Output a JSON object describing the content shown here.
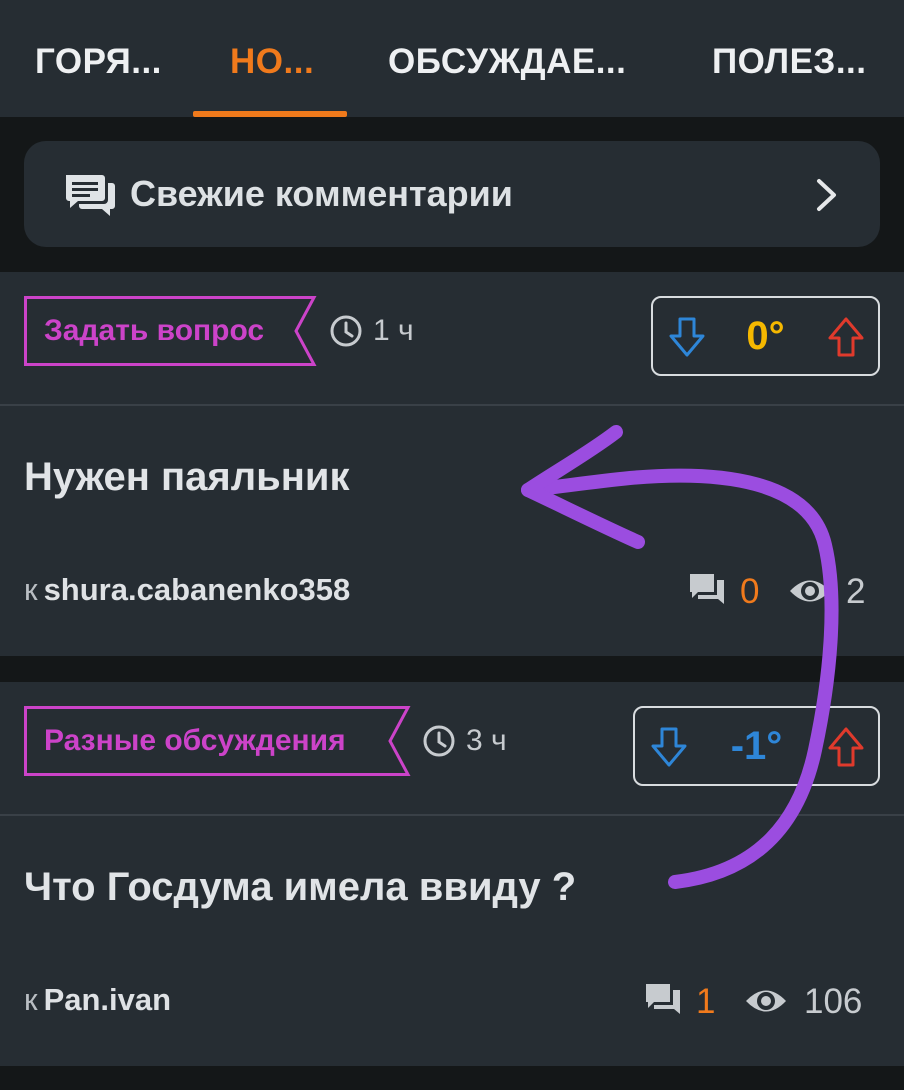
{
  "tabs": [
    {
      "label": "ГОРЯ...",
      "active": false
    },
    {
      "label": "НО...",
      "active": true
    },
    {
      "label": "ОБСУЖДАЕ...",
      "active": false
    },
    {
      "label": "ПОЛЕЗ...",
      "active": false
    }
  ],
  "fresh_comments": {
    "label": "Свежие комментарии"
  },
  "posts": [
    {
      "category": "Задать вопрос",
      "time": "1 ч",
      "score": "0°",
      "title": "Нужен паяльник",
      "author_prefix": "к",
      "author": "shura.cabanenko358",
      "comments": "0",
      "views": "2"
    },
    {
      "category": "Разные обсуждения",
      "time": "3 ч",
      "score": "-1°",
      "title": "Что Госдума имела ввиду ?",
      "author_prefix": "к",
      "author": "Pan.ivan",
      "comments": "1",
      "views": "106"
    }
  ],
  "colors": {
    "accent": "#f07a1c",
    "tag": "#cc43c9",
    "score_zero": "#f5b800",
    "score_negative": "#2e86d8",
    "vote_down": "#2e86d8",
    "vote_up": "#e03a2c",
    "annotation_arrow": "#9b4de0"
  },
  "icons": [
    "comments-icon",
    "chevron-right-icon",
    "clock-icon",
    "arrow-down-icon",
    "arrow-up-icon",
    "comment-icon",
    "eye-icon"
  ]
}
